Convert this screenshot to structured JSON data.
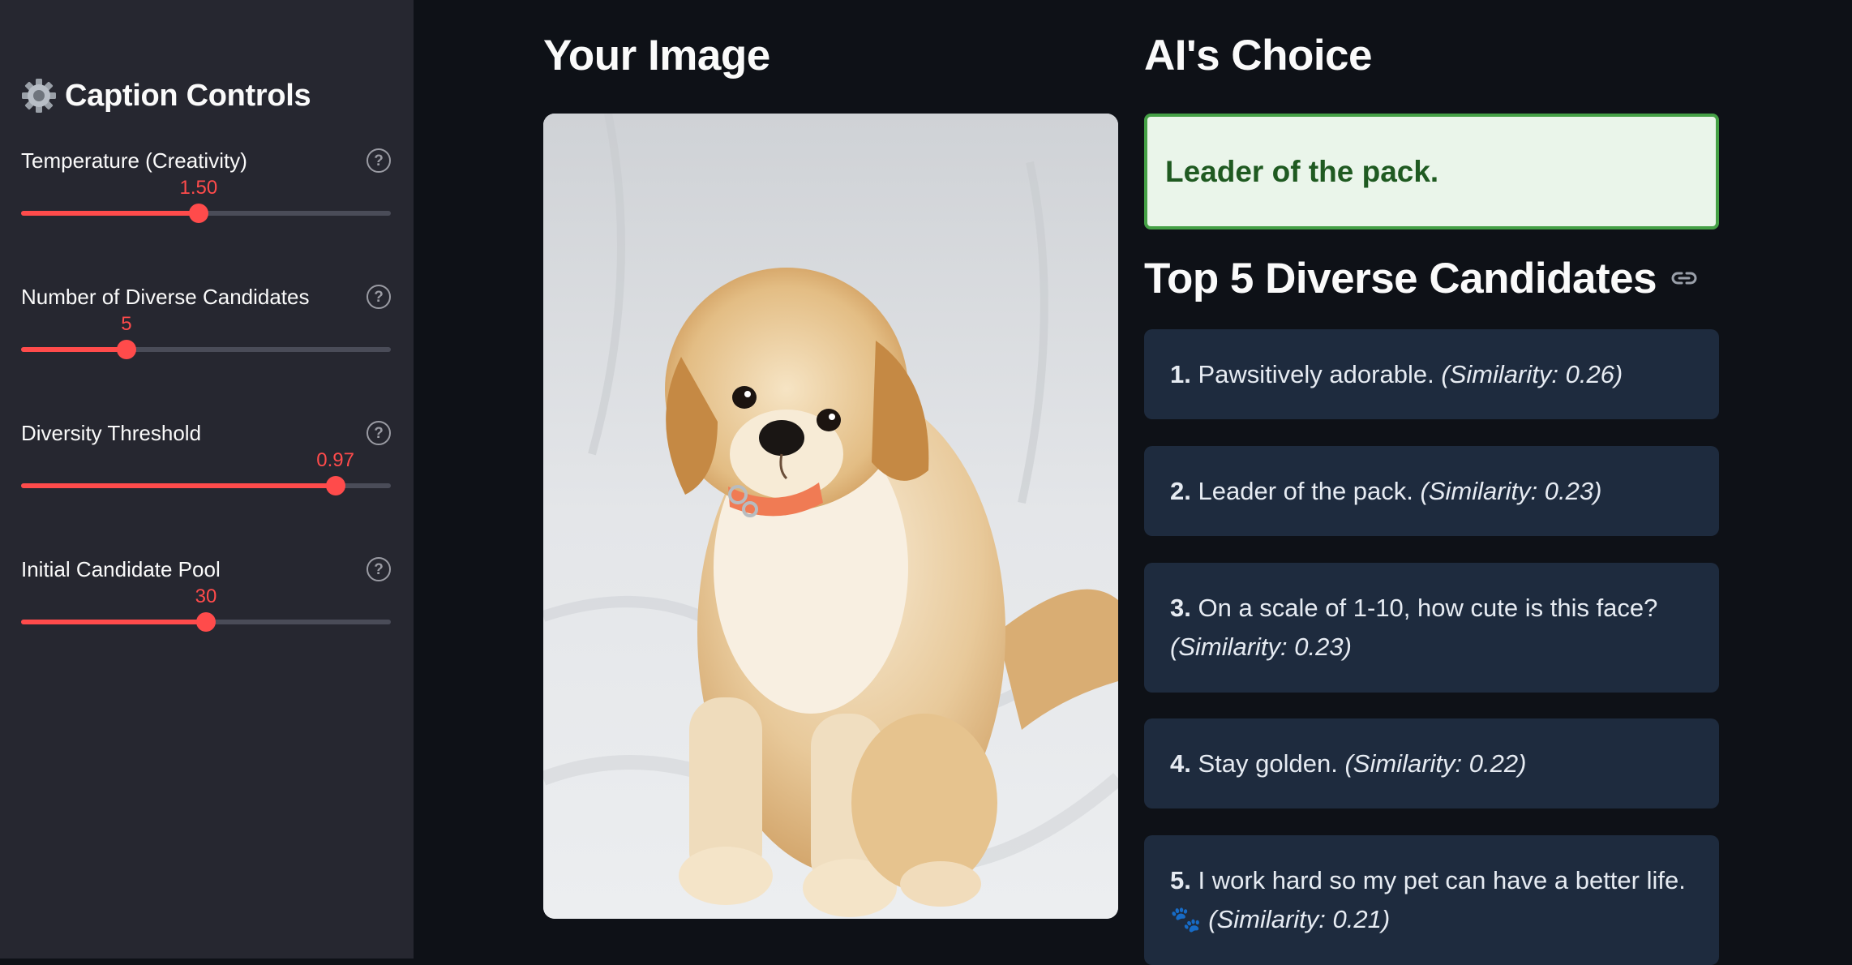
{
  "sidebar": {
    "title": "Caption Controls",
    "sliders": [
      {
        "label": "Temperature (Creativity)",
        "value": "1.50",
        "fraction": 0.48
      },
      {
        "label": "Number of Diverse Candidates",
        "value": "5",
        "fraction": 0.285
      },
      {
        "label": "Diversity Threshold",
        "value": "0.97",
        "fraction": 0.85
      },
      {
        "label": "Initial Candidate Pool",
        "value": "30",
        "fraction": 0.5
      }
    ],
    "help_glyph": "?"
  },
  "main": {
    "your_image_title": "Your Image",
    "ai_choice_title": "AI's Choice",
    "ai_choice_caption": "Leader of the pack.",
    "candidates_title": "Top 5 Diverse Candidates",
    "candidates": [
      {
        "num": "1.",
        "text": "Pawsitively adorable.",
        "sim": "(Similarity: 0.26)"
      },
      {
        "num": "2.",
        "text": "Leader of the pack.",
        "sim": "(Similarity: 0.23)"
      },
      {
        "num": "3.",
        "text": "On a scale of 1-10, how cute is this face?",
        "sim": "(Similarity: 0.23)"
      },
      {
        "num": "4.",
        "text": "Stay golden.",
        "sim": "(Similarity: 0.22)"
      },
      {
        "num": "5.",
        "text": "I work hard so my pet can have a better life.",
        "emoji": "🐾",
        "sim": "(Similarity: 0.21)"
      }
    ]
  },
  "colors": {
    "accent": "#ff4b4b",
    "success_border": "#45a046",
    "success_bg": "#eaf5ea",
    "card_bg": "#1e2b3e"
  }
}
